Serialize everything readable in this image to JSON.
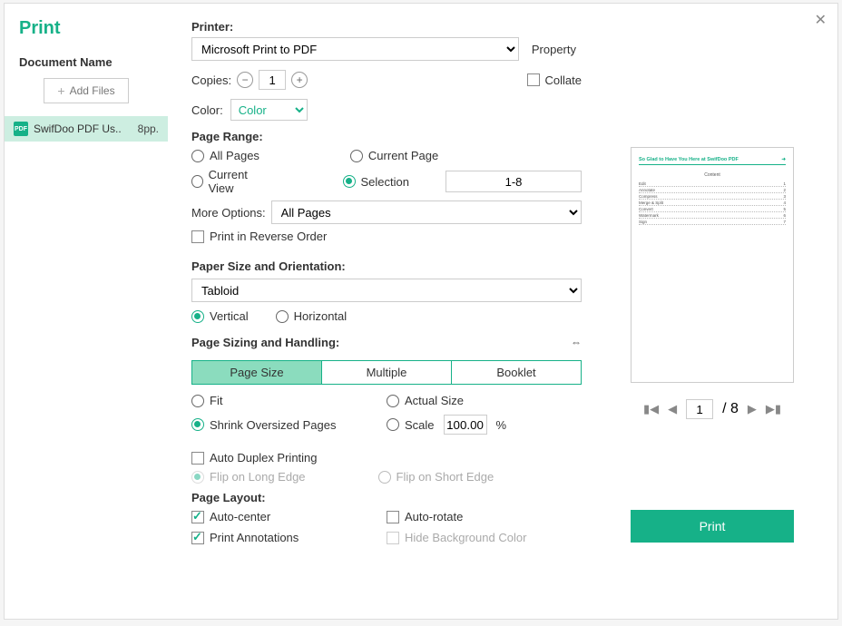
{
  "title": "Print",
  "sidebar": {
    "doc_label": "Document Name",
    "add_files": "Add Files",
    "file": {
      "name": "SwifDoo PDF Us..",
      "pages": "8pp."
    }
  },
  "printer": {
    "label": "Printer:",
    "value": "Microsoft Print to PDF",
    "property": "Property",
    "copies_label": "Copies:",
    "copies": "1",
    "collate": "Collate",
    "color_label": "Color:",
    "color_value": "Color"
  },
  "range": {
    "label": "Page Range:",
    "all": "All Pages",
    "current_page": "Current Page",
    "current_view": "Current View",
    "selection": "Selection",
    "selection_value": "1-8",
    "more_opt_label": "More Options:",
    "more_opt_value": "All Pages",
    "reverse": "Print in Reverse Order"
  },
  "paper": {
    "label": "Paper Size and Orientation:",
    "size": "Tabloid",
    "vertical": "Vertical",
    "horizontal": "Horizontal"
  },
  "sizing": {
    "label": "Page Sizing and Handling:",
    "tabs": {
      "page_size": "Page Size",
      "multiple": "Multiple",
      "booklet": "Booklet"
    },
    "fit": "Fit",
    "actual": "Actual Size",
    "shrink": "Shrink Oversized Pages",
    "scale": "Scale",
    "scale_value": "100.00",
    "scale_unit": "%"
  },
  "duplex": {
    "auto": "Auto Duplex Printing",
    "long": "Flip on Long Edge",
    "short": "Flip on Short Edge"
  },
  "layout": {
    "label": "Page Layout:",
    "auto_center": "Auto-center",
    "auto_rotate": "Auto-rotate",
    "annotations": "Print Annotations",
    "hide_bg": "Hide Background Color"
  },
  "preview": {
    "header": "So Glad to Have You Here at SwifDoo PDF",
    "content_title": "Content",
    "toc": [
      "Edit",
      "Annotate",
      "Compress",
      "Merge & Split",
      "Convert",
      "Watermark",
      "Sign"
    ],
    "pager": {
      "current": "1",
      "total": "/ 8"
    }
  },
  "print_button": "Print"
}
